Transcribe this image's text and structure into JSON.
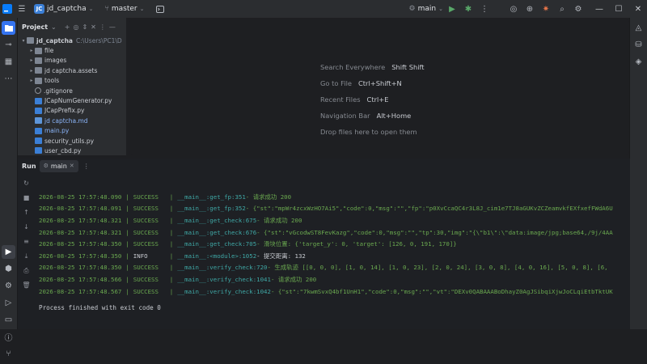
{
  "titlebar": {
    "project_name": "jd_captcha",
    "project_badge": "JC",
    "branch": "master",
    "run_config": "main"
  },
  "project_panel": {
    "title": "Project",
    "tree": [
      {
        "name": "jd_captcha",
        "path": "C:\\Users\\PC1\\D",
        "type": "root",
        "expanded": true
      },
      {
        "name": "file",
        "type": "folder"
      },
      {
        "name": "images",
        "type": "folder"
      },
      {
        "name": "jd captcha.assets",
        "type": "folder"
      },
      {
        "name": "tools",
        "type": "folder"
      },
      {
        "name": ".gitignore",
        "type": "git"
      },
      {
        "name": "JCapNumGenerator.py",
        "type": "py"
      },
      {
        "name": "JCapPrefix.py",
        "type": "py"
      },
      {
        "name": "jd captcha.md",
        "type": "md"
      },
      {
        "name": "main.py",
        "type": "py"
      },
      {
        "name": "security_utils.py",
        "type": "py"
      },
      {
        "name": "user_cbd.py",
        "type": "py"
      }
    ]
  },
  "editor_hints": [
    {
      "label": "Search Everywhere",
      "key": "Shift Shift"
    },
    {
      "label": "Go to File",
      "key": "Ctrl+Shift+N"
    },
    {
      "label": "Recent Files",
      "key": "Ctrl+E"
    },
    {
      "label": "Navigation Bar",
      "key": "Alt+Home"
    },
    {
      "label": "Drop files here to open them",
      "key": ""
    }
  ],
  "run_panel": {
    "title": "Run",
    "tab": "main",
    "logs": [
      {
        "ts": "2026-08-25 17:57:48.090",
        "level": "SUCCESS",
        "mod": "__main__:get_fp:351",
        "msg": "- 请求成功 200"
      },
      {
        "ts": "2026-08-25 17:57:48.091",
        "level": "SUCCESS",
        "mod": "__main__:get_fp:352",
        "msg": "- {\"st\":\"mpWr4zcxWzHO7Ai5\",\"code\":0,\"msg\":\"\",\"fp\":\"p0XvCcaQC4r3L8J_cim1e7TJ8aGUKvZCZeamvkfEXfxefFWdA6U"
      },
      {
        "ts": "2026-08-25 17:57:48.321",
        "level": "SUCCESS",
        "mod": "__main__:get_check:675",
        "msg": "- 请求成功 200"
      },
      {
        "ts": "2026-08-25 17:57:48.321",
        "level": "SUCCESS",
        "mod": "__main__:get_check:676",
        "msg": "- {\"st\":\"vGcodwST8FevKazg\",\"code\":0,\"msg\":\"\",\"tp\":30,\"img\":\"{\\\"b1\\\":\\\"data:image/jpg;base64,/9j/4AA"
      },
      {
        "ts": "2026-08-25 17:57:48.350",
        "level": "SUCCESS",
        "mod": "__main__:get_check:705",
        "msg": "- 滑块位置: {'target_y': 0, 'target': [126, 0, 191, 170]}"
      },
      {
        "ts": "2026-08-25 17:57:48.350",
        "level": "INFO",
        "mod": "__main__:<module>:1052",
        "msg": "- 提交距离: 132"
      },
      {
        "ts": "2026-08-25 17:57:48.350",
        "level": "SUCCESS",
        "mod": "__main__:verify_check:720",
        "msg": "- 生成轨迹 [[0, 0, 0], [1, 0, 14], [1, 0, 23], [2, 0, 24], [3, 0, 8], [4, 0, 16], [5, 0, 8], [6,"
      },
      {
        "ts": "2026-08-25 17:57:48.566",
        "level": "SUCCESS",
        "mod": "__main__:verify_check:1041",
        "msg": "- 请求成功 200"
      },
      {
        "ts": "2026-08-25 17:57:48.567",
        "level": "SUCCESS",
        "mod": "__main__:verify_check:1042",
        "msg": "- {\"st\":\"7kwmSvxQ4bf1UnH1\",\"code\":0,\"msg\":\"\",\"vt\":\"DEXv0QABAAABoDhayZ0AgJSibqiXjwJoCLqiEtbTktUK"
      }
    ],
    "finish_text": "Process finished with exit code 0"
  }
}
